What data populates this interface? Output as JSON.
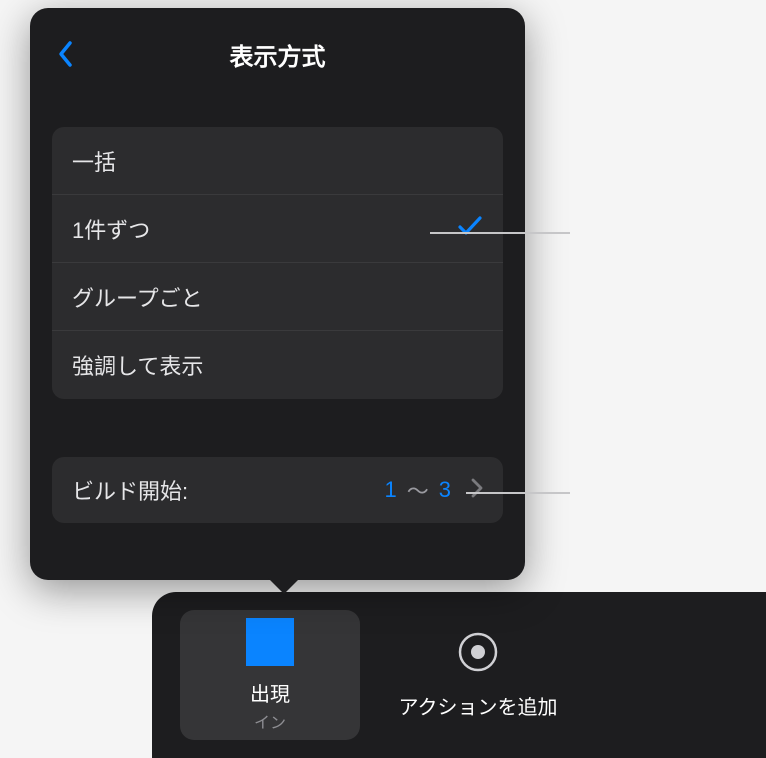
{
  "header": {
    "title": "表示方式"
  },
  "options": [
    {
      "label": "一括",
      "selected": false
    },
    {
      "label": "1件ずつ",
      "selected": true
    },
    {
      "label": "グループごと",
      "selected": false
    },
    {
      "label": "強調して表示",
      "selected": false
    }
  ],
  "build": {
    "label": "ビルド開始:",
    "from": "1",
    "separator": "〜",
    "to": "3"
  },
  "bottom": {
    "appear": {
      "label": "出現",
      "sublabel": "イン"
    },
    "addAction": {
      "label": "アクションを追加"
    }
  }
}
